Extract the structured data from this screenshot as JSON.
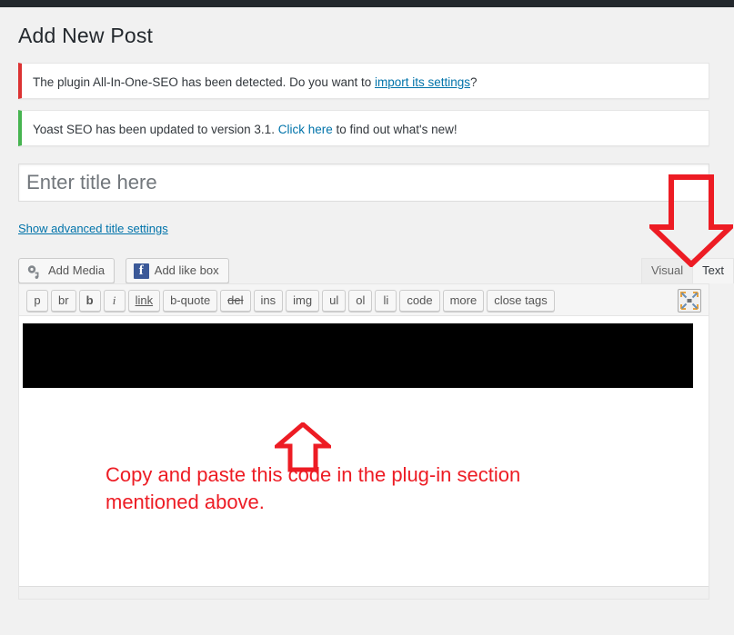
{
  "adminbar": {
    "name": "wp-admin-bar"
  },
  "page": {
    "title": "Add New Post"
  },
  "notices": [
    {
      "type": "error",
      "accent": "#dc3232",
      "text_before": "The plugin All-In-One-SEO has been detected. Do you want to ",
      "link": "import its settings",
      "text_after": "?"
    },
    {
      "type": "success",
      "accent": "#46b450",
      "text_before": "Yoast SEO has been updated to version 3.1. ",
      "link": "Click here",
      "text_after": " to find out what's new!"
    }
  ],
  "title_field": {
    "placeholder": "Enter title here",
    "value": ""
  },
  "advanced_title": {
    "label": "Show advanced title settings"
  },
  "media_buttons": [
    {
      "label": "Add Media",
      "icon": "media-icon"
    },
    {
      "label": "Add like box",
      "icon": "facebook-icon"
    }
  ],
  "editor_tabs": [
    {
      "label": "Visual",
      "active": false
    },
    {
      "label": "Text",
      "active": true
    }
  ],
  "quicktags": [
    {
      "label": "p",
      "style": "plain"
    },
    {
      "label": "br",
      "style": "plain"
    },
    {
      "label": "b",
      "style": "bold"
    },
    {
      "label": "i",
      "style": "italic"
    },
    {
      "label": "link",
      "style": "underline"
    },
    {
      "label": "b-quote",
      "style": "plain"
    },
    {
      "label": "del",
      "style": "strike"
    },
    {
      "label": "ins",
      "style": "plain"
    },
    {
      "label": "img",
      "style": "plain"
    },
    {
      "label": "ul",
      "style": "plain"
    },
    {
      "label": "ol",
      "style": "plain"
    },
    {
      "label": "li",
      "style": "plain"
    },
    {
      "label": "code",
      "style": "plain"
    },
    {
      "label": "more",
      "style": "plain"
    },
    {
      "label": "close tags",
      "style": "plain"
    }
  ],
  "dfw_button": {
    "icon": "fullscreen-expand-icon"
  },
  "editor": {
    "content_redacted": true
  },
  "annotations": {
    "color": "#ed1c24",
    "text": "Copy and paste this code in the plug-in section\nmentioned above.",
    "arrow_up": "arrow-up-icon",
    "arrow_down": "arrow-down-icon"
  }
}
